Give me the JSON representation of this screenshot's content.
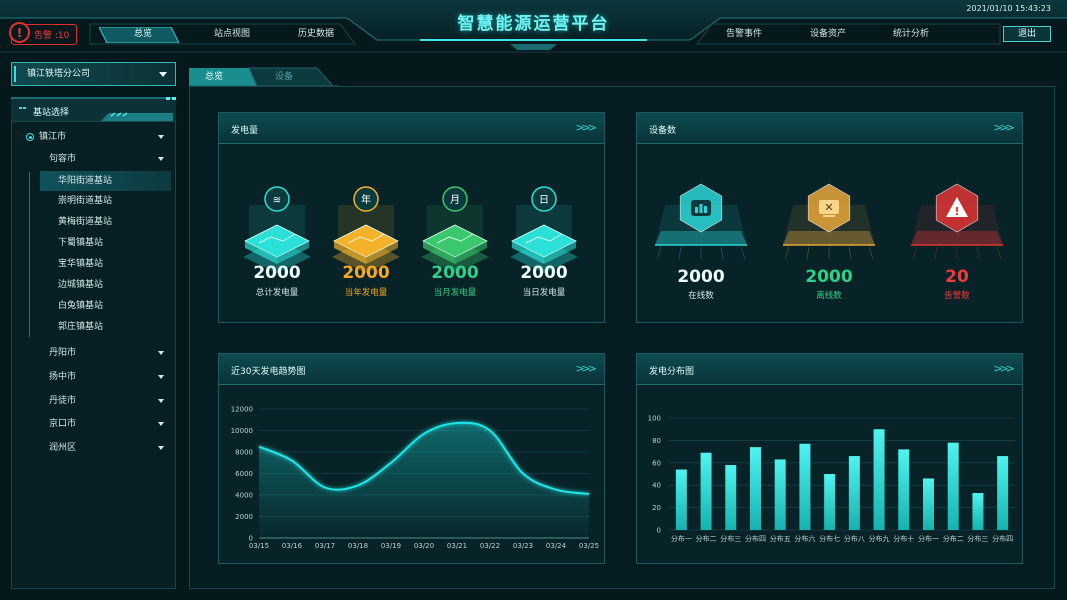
{
  "header": {
    "title": "智慧能源运营平台",
    "datetime": "2021/01/10 15:43:23",
    "alarm_label": "告警 :10",
    "alarm_icon": "!",
    "nav_left": [
      "总览",
      "站点视图",
      "历史数据"
    ],
    "nav_right": [
      "告警事件",
      "设备资产",
      "统计分析"
    ],
    "active_nav": "总览",
    "logout": "退出"
  },
  "sidebar": {
    "company": "镇江铁塔分公司",
    "station_section": "基站选择",
    "tree": {
      "root": "镇江市",
      "child": "句容市",
      "stations": [
        "华阳街道基站",
        "崇明街道基站",
        "黄梅街道基站",
        "下蜀镇基站",
        "宝华镇基站",
        "边城镇基站",
        "白兔镇基站",
        "郭庄镇基站"
      ],
      "selected_station": "华阳街道基站",
      "other_cities": [
        "丹阳市",
        "扬中市",
        "丹徒市",
        "京口市",
        "润州区"
      ]
    }
  },
  "tabs": [
    {
      "label": "总览",
      "active": true
    },
    {
      "label": "设备",
      "active": false
    }
  ],
  "power_card": {
    "title": "发电量",
    "items": [
      {
        "value": "2000",
        "label": "总计发电量",
        "color": "#eafcff",
        "label_color": "#d3e8ea",
        "icon": "stack-icon",
        "glyph": "≋",
        "tile": "#2be0d6"
      },
      {
        "value": "2000",
        "label": "当年发电量",
        "color": "#f6a623",
        "label_color": "#f6a623",
        "icon": "year-icon",
        "glyph": "年",
        "tile": "#f3b22a"
      },
      {
        "value": "2000",
        "label": "当月发电量",
        "color": "#2fd08a",
        "label_color": "#2fd08a",
        "icon": "month-icon",
        "glyph": "月",
        "tile": "#3bc76b"
      },
      {
        "value": "2000",
        "label": "当日发电量",
        "color": "#eafcff",
        "label_color": "#d3e8ea",
        "icon": "day-icon",
        "glyph": "日",
        "tile": "#2be0d6"
      }
    ]
  },
  "device_card": {
    "title": "设备数",
    "items": [
      {
        "value": "2000",
        "label": "在线数",
        "color": "#eafcff",
        "label_color": "#d3e8ea",
        "icon": "online-icon",
        "accent": "#2bd6d6"
      },
      {
        "value": "2000",
        "label": "离线数",
        "color": "#2fd08a",
        "label_color": "#2fd08a",
        "icon": "offline-icon",
        "accent": "#e8a73a"
      },
      {
        "value": "20",
        "label": "告警数",
        "color": "#ef3b3b",
        "label_color": "#ef3b3b",
        "icon": "warning-icon",
        "accent": "#e03434"
      }
    ]
  },
  "trend_card": {
    "title": "近30天发电趋势图"
  },
  "dist_card": {
    "title": "发电分布图"
  },
  "chart_data": [
    {
      "type": "area",
      "x": [
        "03/15",
        "03/16",
        "03/17",
        "03/18",
        "03/19",
        "03/20",
        "03/21",
        "03/22",
        "03/23",
        "03/24",
        "03/25"
      ],
      "y": [
        8500,
        7200,
        4700,
        4900,
        7000,
        9700,
        10700,
        10000,
        6000,
        4500,
        4100
      ],
      "ylim": [
        0,
        12000
      ],
      "yticks": [
        0,
        2000,
        4000,
        6000,
        8000,
        10000,
        12000
      ],
      "grid": true,
      "color": "#1fe6e6"
    },
    {
      "type": "bar",
      "categories": [
        "分布一",
        "分布二",
        "分布三",
        "分布四",
        "分布五",
        "分布六",
        "分布七",
        "分布八",
        "分布九",
        "分布十",
        "分布一",
        "分布二",
        "分布三",
        "分布四"
      ],
      "values": [
        54,
        69,
        58,
        74,
        63,
        77,
        50,
        66,
        90,
        72,
        46,
        78,
        33,
        66
      ],
      "ylim": [
        0,
        100
      ],
      "yticks": [
        0,
        20,
        40,
        60,
        80,
        100
      ],
      "grid": true,
      "color": "#2ce6d6"
    }
  ]
}
